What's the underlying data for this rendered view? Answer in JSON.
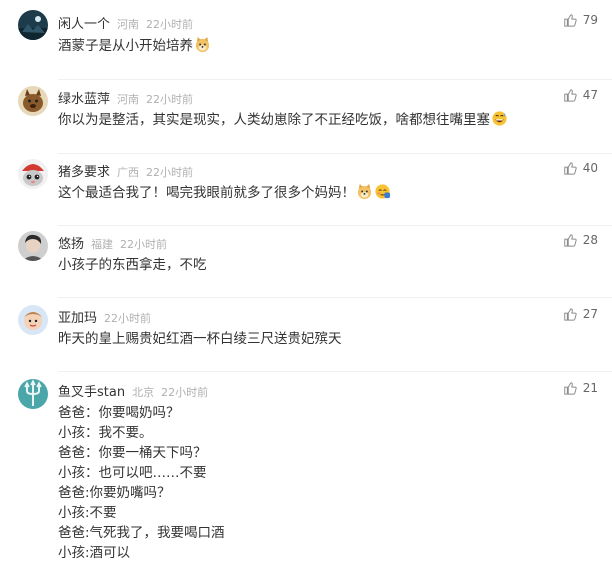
{
  "comments": [
    {
      "username": "闲人一个",
      "location": "河南",
      "time": "22小时前",
      "likes": "79",
      "lines": [
        "酒蒙子是从小开始培养"
      ],
      "trailing_emoji": "doge-icon",
      "avatar": "dark-landscape-avatar"
    },
    {
      "username": "绿水蓝萍",
      "location": "河南",
      "time": "22小时前",
      "likes": "47",
      "lines": [
        "你以为是整活，其实是现实，人类幼崽除了不正经吃饭，啥都想往嘴里塞"
      ],
      "trailing_emoji": "grin-sweat-icon",
      "avatar": "brown-animal-avatar"
    },
    {
      "username": "猪多要求",
      "location": "广西",
      "time": "22小时前",
      "likes": "40",
      "lines": [
        "这个最适合我了！喝完我眼前就多了很多个妈妈！"
      ],
      "trailing_emoji": "doge-and-shy-icons",
      "avatar": "red-hat-cat-avatar"
    },
    {
      "username": "悠扬",
      "location": "福建",
      "time": "22小时前",
      "likes": "28",
      "lines": [
        "小孩子的东西拿走，不吃"
      ],
      "avatar": "portrait-avatar"
    },
    {
      "username": "亚加玛",
      "location": "",
      "time": "22小时前",
      "likes": "27",
      "lines": [
        "昨天的皇上赐贵妃红酒一杯白绫三尺送贵妃殡天"
      ],
      "avatar": "cartoon-face-avatar"
    },
    {
      "username": "鱼叉手stan",
      "location": "北京",
      "time": "22小时前",
      "likes": "21",
      "lines": [
        "爸爸：你要喝奶吗？",
        "小孩：我不要。",
        "爸爸：你要一桶天下吗？",
        "小孩：也可以吧……不要",
        "爸爸:你要奶嘴吗？",
        "小孩:不要",
        "爸爸:气死我了，我要喝口酒",
        "小孩:酒可以"
      ],
      "avatar": "trident-avatar"
    }
  ],
  "colors": {
    "username": "#333333",
    "meta": "#b0b0b0",
    "body_text": "#333333",
    "like_icon": "#8a8a8a"
  }
}
